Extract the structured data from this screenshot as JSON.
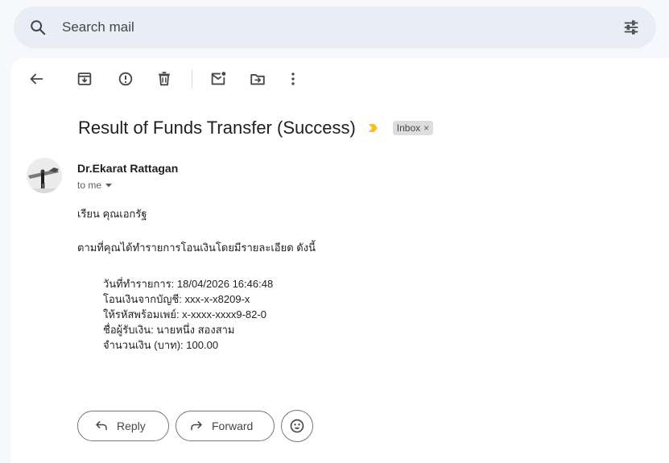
{
  "search": {
    "placeholder": "Search mail",
    "icon": "search-icon",
    "tune_icon": "tune-icon"
  },
  "toolbar": {
    "items": [
      "back-arrow-icon",
      "archive-icon",
      "report-spam-icon",
      "delete-icon",
      "mark-unread-icon",
      "move-to-icon",
      "more-vert-icon"
    ]
  },
  "email": {
    "subject": "Result of Funds Transfer (Success)",
    "label": "Inbox",
    "label_close": "×",
    "sender": "Dr.Ekarat Rattagan",
    "recipient": "to me",
    "greeting": "เรียน คุณเอกรัฐ",
    "intro": "ตามที่คุณได้ทำรายการโอนเงินโดยมีรายละเอียด ดังนี้",
    "details": [
      "วันที่ทำรายการ: 18/04/2026  16:46:48",
      "โอนเงินจากบัญชี: xxx-x-x8209-x",
      "ให้รหัสพร้อมเพย์: x-xxxx-xxxx9-82-0",
      "ชื่อผู้รับเงิน: นายหนึ่ง สองสาม",
      "จำนวนเงิน (บาท): 100.00"
    ]
  },
  "actions": {
    "reply_label": "Reply",
    "forward_label": "Forward"
  },
  "colors": {
    "background": "#f6f8fc",
    "search_bg": "#e9eef6",
    "importance": "#f6bf26",
    "chip_bg": "#dddddd"
  }
}
